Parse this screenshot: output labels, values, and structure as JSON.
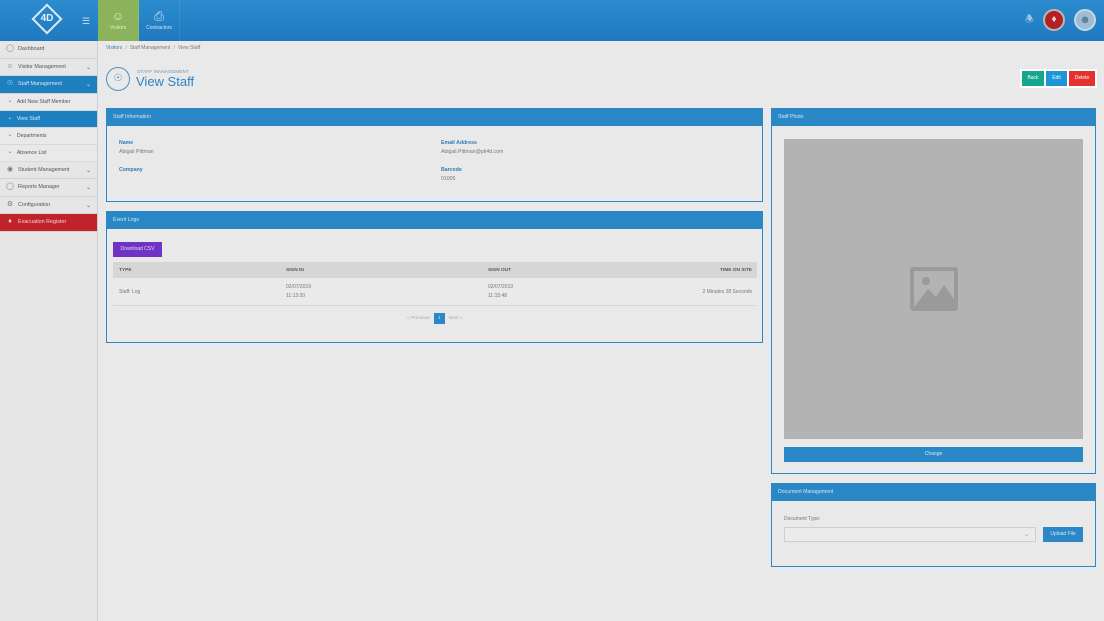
{
  "topbar": {
    "logo_text": "4D",
    "nav": [
      {
        "label": "Visitors",
        "icon": "person-icon"
      },
      {
        "label": "Contractors",
        "icon": "clipboard-icon"
      }
    ]
  },
  "sidebar": {
    "items": [
      {
        "label": "Dashboard"
      },
      {
        "label": "Visitor Management"
      },
      {
        "label": "Staff Management"
      },
      {
        "label": "Add New Staff Member"
      },
      {
        "label": "View Staff"
      },
      {
        "label": "Departments"
      },
      {
        "label": "Absence List"
      },
      {
        "label": "Student Management"
      },
      {
        "label": "Reports Manager"
      },
      {
        "label": "Configuration"
      },
      {
        "label": "Evacuation Register"
      }
    ]
  },
  "breadcrumb": [
    "Visitors",
    "Staff Management",
    "View Staff"
  ],
  "page": {
    "subtitle": "STAFF MANAGEMENT",
    "title": "View Staff"
  },
  "actions": {
    "back": "Back",
    "edit": "Edit",
    "delete": "Delete"
  },
  "staff_info": {
    "heading": "Staff Information",
    "name_label": "Name",
    "name_value": "Abigail Pittman",
    "email_label": "Email Address",
    "email_value": "Abigail.Pittman@pti4d.com",
    "company_label": "Company",
    "company_value": "",
    "barcode_label": "Barcode",
    "barcode_value": "01005"
  },
  "event_logs": {
    "heading": "Event Logs",
    "csv_button": "Download CSV",
    "columns": [
      "TYPE",
      "SIGN IN",
      "SIGN OUT",
      "TIME ON SITE"
    ],
    "rows": [
      {
        "type": "Staff: Log",
        "sign_in_date": "02/07/2019",
        "sign_in_time": "11:13:20",
        "sign_out_date": "02/07/2019",
        "sign_out_time": "11:15:48",
        "time_on_site": "2 Minutes 28 Seconds"
      }
    ],
    "pager": {
      "prev": "« Previous",
      "page": "1",
      "next": "Next »"
    }
  },
  "staff_photo": {
    "heading": "Staff Photo",
    "change_button": "Change"
  },
  "documents": {
    "heading": "Document Management",
    "type_label": "Document Type:",
    "type_value": "",
    "upload_button": "Upload File"
  }
}
